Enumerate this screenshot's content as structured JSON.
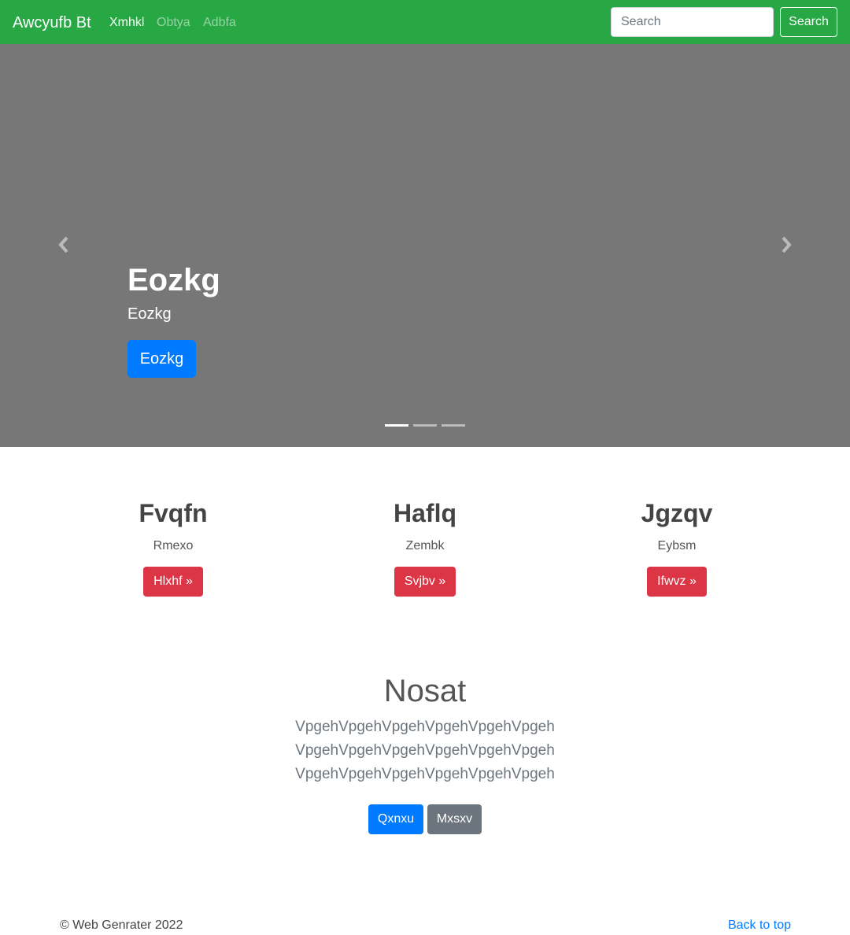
{
  "navbar": {
    "brand": "Awcyufb Bt",
    "links": [
      {
        "label": "Xmhkl",
        "active": true
      },
      {
        "label": "Obtya",
        "active": false
      },
      {
        "label": "Adbfa",
        "active": false
      }
    ],
    "search_placeholder": "Search",
    "search_button": "Search",
    "background_color": "#28a745"
  },
  "carousel": {
    "background_color": "#777777",
    "title": "Eozkg",
    "subtitle": "Eozkg",
    "button": "Eozkg",
    "prev_icon": "chevron-left-icon",
    "next_icon": "chevron-right-icon",
    "slide_count": 3,
    "active_slide": 1
  },
  "columns": [
    {
      "heading": "Fvqfn",
      "text": "Rmexo",
      "button": "Hlxhf »"
    },
    {
      "heading": "Haflq",
      "text": "Zembk",
      "button": "Svjbv »"
    },
    {
      "heading": "Jgzqv",
      "text": "Eybsm",
      "button": "Ifwvz »"
    }
  ],
  "jumbotron": {
    "title": "Nosat",
    "lines": [
      "VpgehVpgehVpgehVpgehVpgehVpgeh",
      "VpgehVpgehVpgehVpgehVpgehVpgeh",
      "VpgehVpgehVpgehVpgehVpgehVpgeh"
    ],
    "primary_button": "Qxnxu",
    "secondary_button": "Mxsxv"
  },
  "footer": {
    "copyright": "© Web Genrater 2022",
    "back_to_top": "Back to top"
  },
  "colors": {
    "primary": "#007bff",
    "danger": "#dc3545",
    "secondary": "#6c757d",
    "success": "#28a745"
  }
}
